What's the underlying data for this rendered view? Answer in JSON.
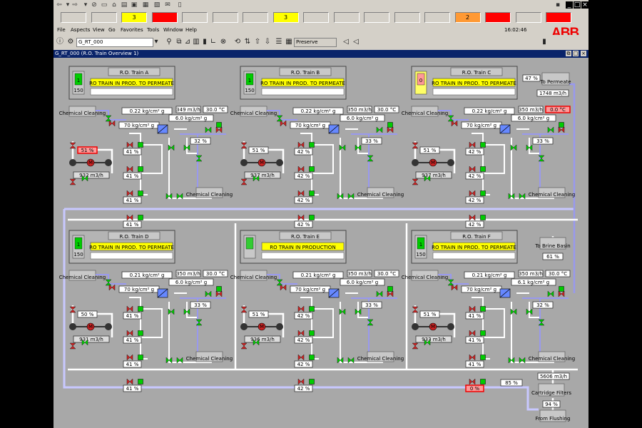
{
  "menu": [
    "File",
    "Aspects",
    "View",
    "Go",
    "Favorites",
    "Tools",
    "Window",
    "Help"
  ],
  "alarm_slots": [
    {
      "label": "",
      "color": ""
    },
    {
      "label": "",
      "color": ""
    },
    {
      "label": "3",
      "color": "#ffff00"
    },
    {
      "label": "",
      "color": "#ff0000"
    },
    {
      "label": "",
      "color": ""
    },
    {
      "label": "",
      "color": ""
    },
    {
      "label": "",
      "color": ""
    },
    {
      "label": "3",
      "color": "#ffff00"
    },
    {
      "label": "",
      "color": ""
    },
    {
      "label": "",
      "color": ""
    },
    {
      "label": "",
      "color": ""
    },
    {
      "label": "",
      "color": ""
    },
    {
      "label": "",
      "color": ""
    },
    {
      "label": "2",
      "color": "#ff9933"
    },
    {
      "label": "",
      "color": "#ff0000"
    },
    {
      "label": "",
      "color": ""
    },
    {
      "label": "",
      "color": "#ff0000"
    }
  ],
  "toolbar": {
    "address": "G_RT_000",
    "preset": "Preserve"
  },
  "clock": "16:02:46",
  "logo": "ABB",
  "window_title": "G_RT_000 (R.O. Train Overview 1)",
  "right_panel": {
    "top_pct": "47 %",
    "to_permeate": "To Permeate",
    "permeate_flow": "1748 m3/h",
    "to_brine": "To Brine Basin",
    "brine_pct": "61 %",
    "bottom_flow": "5606 m3/h",
    "cart_pct": "85 %",
    "cartridge": "Cartridge Filters",
    "flush_pct": "94 %",
    "from_flushing": "From Flushing"
  },
  "common": {
    "chem": "Chemical Cleaning",
    "pct_unit": "%"
  },
  "trains": [
    {
      "name": "R.O. Train A",
      "status": "RO TRAIN IN PROD. TO PERMEATE",
      "icon": "1",
      "sub": "150",
      "kg1": "0.22 kg/cm² g",
      "flow": "349 m3/h",
      "temp": "30.0 °C",
      "kg2": "6.0 kg/cm² g",
      "kg3": "70 kg/cm² g",
      "valve_pct": "51 %",
      "pump_flow": "932 m3/h",
      "vessel": [
        "41 %",
        "41 %",
        "41 %",
        "41 %"
      ],
      "out_pct": "32 %",
      "alarm_valve": true
    },
    {
      "name": "R.O. Train B",
      "status": "RO TRAIN IN PROD. TO PERMEATE",
      "icon": "1",
      "sub": "150",
      "kg1": "0.22 kg/cm² g",
      "flow": "350 m3/h",
      "temp": "30.0 °C",
      "kg2": "6.0 kg/cm² g",
      "kg3": "70 kg/cm² g",
      "valve_pct": "51 %",
      "pump_flow": "937 m3/h",
      "vessel": [
        "42 %",
        "42 %",
        "42 %",
        "42 %"
      ],
      "out_pct": "33 %",
      "alarm_valve": false
    },
    {
      "name": "R.O. Train C",
      "status": "RO TRAIN IN PROD. TO PERMEATE",
      "icon": "0",
      "sub": "",
      "kg1": "0.22 kg/cm² g",
      "flow": "350 m3/h",
      "temp": "0.0 °C",
      "kg2": "6.0 kg/cm² g",
      "kg3": "70 kg/cm² g",
      "valve_pct": "51 %",
      "pump_flow": "937 m3/h",
      "vessel": [
        "42 %",
        "42 %",
        "42 %",
        "42 %"
      ],
      "out_pct": "33 %",
      "alarm_valve": false
    },
    {
      "name": "R.O. Train D",
      "status": "RO TRAIN IN PROD. TO PERMEATE",
      "icon": "1",
      "sub": "150",
      "kg1": "0.21 kg/cm² g",
      "flow": "350 m3/h",
      "temp": "30.0 °C",
      "kg2": "6.0 kg/cm² g",
      "kg3": "70 kg/cm² g",
      "valve_pct": "50 %",
      "pump_flow": "931 m3/h",
      "vessel": [
        "41 %",
        "41 %",
        "41 %",
        "41 %"
      ],
      "out_pct": "33 %",
      "alarm_valve": false
    },
    {
      "name": "R.O. Train E",
      "status": "RO TRAIN IN PRODUCTION",
      "icon": "",
      "sub": "",
      "kg1": "0.21 kg/cm² g",
      "flow": "350 m3/h",
      "temp": "30.0 °C",
      "kg2": "6.0 kg/cm² g",
      "kg3": "70 kg/cm² g",
      "valve_pct": "51 %",
      "pump_flow": "936 m3/h",
      "vessel": [
        "42 %",
        "42 %",
        "42 %",
        "42 %"
      ],
      "out_pct": "33 %",
      "alarm_valve": false
    },
    {
      "name": "R.O. Train F",
      "status": "RO TRAIN IN PROD. TO PERMEATE",
      "icon": "1",
      "sub": "150",
      "kg1": "0.21 kg/cm² g",
      "flow": "350 m3/h",
      "temp": "30.0 °C",
      "kg2": "6.1 kg/cm² g",
      "kg3": "70 kg/cm² g",
      "valve_pct": "51 %",
      "pump_flow": "933 m3/h",
      "vessel": [
        "41 %",
        "41 %",
        "41 %",
        "0 %"
      ],
      "out_pct": "32 %",
      "alarm_valve": false
    }
  ]
}
